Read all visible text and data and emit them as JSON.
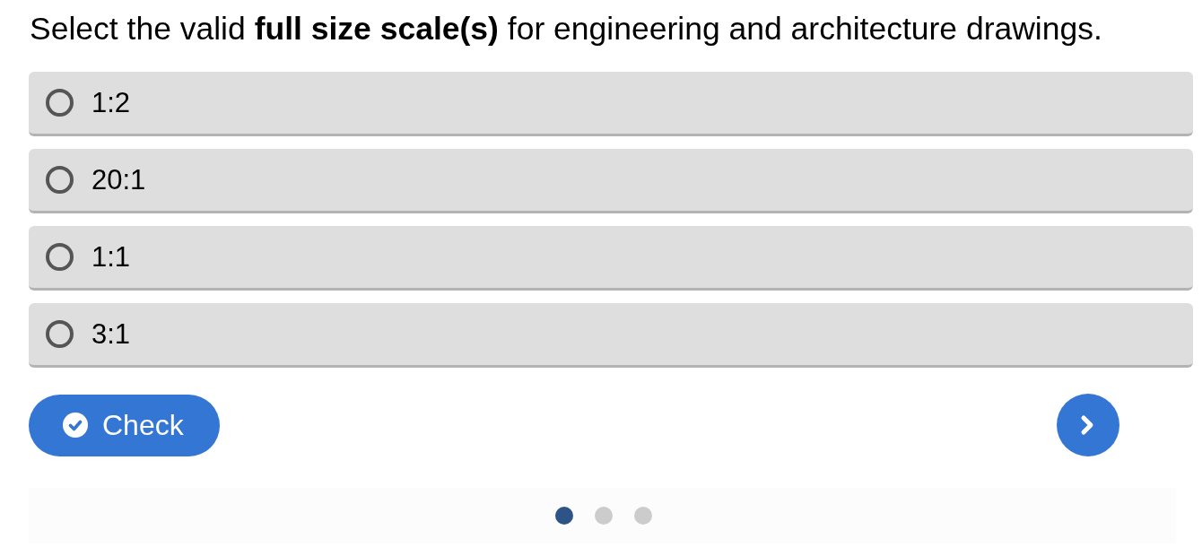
{
  "question": "Select the valid **full size scale(s)** for engineering and architecture drawings.",
  "options": [
    {
      "label": "1:2",
      "selected": false
    },
    {
      "label": "20:1",
      "selected": false
    },
    {
      "label": "1:1",
      "selected": false
    },
    {
      "label": "3:1",
      "selected": false
    }
  ],
  "check_button": {
    "label": "Check"
  },
  "pager": [
    {
      "selected": true
    },
    {
      "selected": false
    },
    {
      "selected": false
    }
  ]
}
